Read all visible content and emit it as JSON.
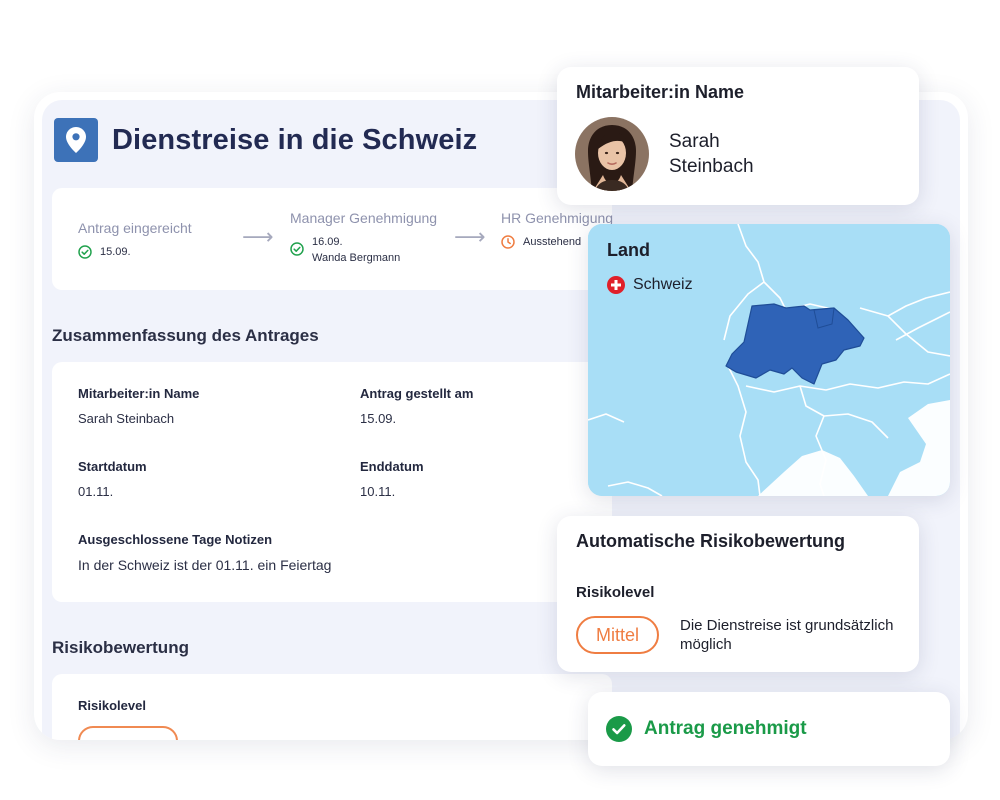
{
  "page": {
    "title": "Dienstreise in die Schweiz"
  },
  "progress": {
    "steps": [
      {
        "label": "Antrag eingereicht",
        "detail": "15.09.",
        "status": "done"
      },
      {
        "label": "Manager Genehmigung",
        "detail": "16.09.",
        "detail2": "Wanda Bergmann",
        "status": "done"
      },
      {
        "label": "HR Genehmigung",
        "detail": "Ausstehend",
        "status": "pending"
      }
    ]
  },
  "summary": {
    "heading": "Zusammenfassung des Antrages",
    "employee_label": "Mitarbeiter:in Name",
    "employee_value": "Sarah Steinbach",
    "submitted_label": "Antrag gestellt am",
    "submitted_value": "15.09.",
    "start_label": "Startdatum",
    "start_value": "01.11.",
    "end_label": "Enddatum",
    "end_value": "10.11.",
    "excluded_label": "Ausgeschlossene Tage Notizen",
    "excluded_value": "In der Schweiz ist der 01.11. ein Feiertag"
  },
  "risk_section": {
    "heading": "Risikobewertung",
    "level_label": "Risikolevel"
  },
  "employee_card": {
    "title": "Mitarbeiter:in Name",
    "first_name": "Sarah",
    "last_name": "Steinbach"
  },
  "country_card": {
    "title": "Land",
    "country": "Schweiz"
  },
  "risk_card": {
    "title": "Automatische Risikobewertung",
    "level_label": "Risikolevel",
    "level_value": "Mittel",
    "description": "Die Dienstreise ist grundsätzlich möglich"
  },
  "status_card": {
    "text": "Antrag genehmigt"
  },
  "colors": {
    "brand_blue": "#3d72b8",
    "success_green": "#1a9a48",
    "warning_orange": "#ef7d42",
    "map_water": "#a8def6",
    "map_highlight": "#2f63b7"
  },
  "icons": {
    "header": "location-pin-icon",
    "done": "check-circle-icon",
    "pending": "clock-icon",
    "arrow": "arrow-right-icon",
    "flag": "swiss-flag-icon",
    "approved": "check-circle-filled-icon"
  }
}
